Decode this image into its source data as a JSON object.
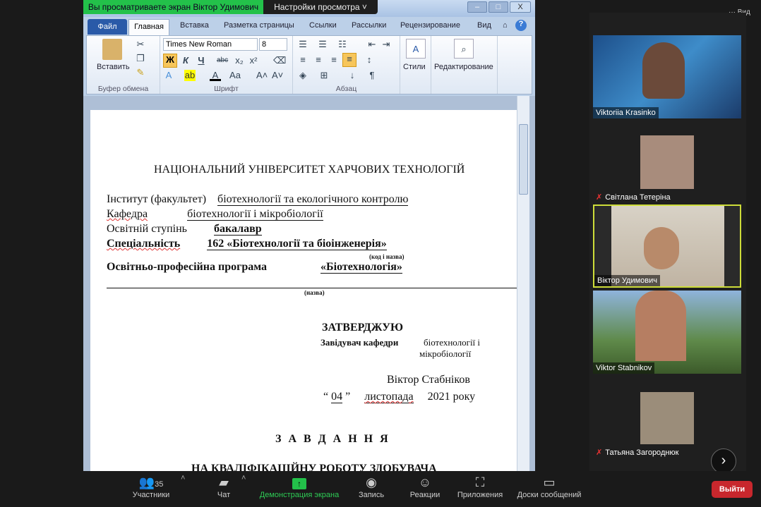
{
  "share_banner": "Вы просматриваете экран Віктор Удимович",
  "view_options": "Настройки просмотра",
  "top_right": "Вид",
  "word": {
    "tabs": [
      "Файл",
      "Главная",
      "Вставка",
      "Разметка страницы",
      "Ссылки",
      "Рассылки",
      "Рецензирование",
      "Вид"
    ],
    "clipboard": {
      "paste": "Вставить",
      "label": "Буфер обмена"
    },
    "font": {
      "name": "Times New Roman",
      "size": "8",
      "label": "Шрифт",
      "bold": "Ж",
      "italic": "К",
      "underline": "Ч"
    },
    "paragraph": {
      "label": "Абзац"
    },
    "styles": "Стили",
    "editing": "Редактирование"
  },
  "doc": {
    "university": "НАЦІОНАЛЬНИЙ УНІВЕРСИТЕТ ХАРЧОВИХ ТЕХНОЛОГІЙ",
    "institute_label": "Інститут (факультет)",
    "institute_value": "біотехнології та екологічного контролю",
    "dept_label": "Кафедра",
    "dept_value": "біотехнології і мікробіології",
    "degree_label": "Освітній ступінь",
    "degree_value": "бакалавр",
    "specialty_label": "Спеціальність",
    "specialty_value": "162 «Біотехнології та біоінженерія»",
    "code_note": "(код і назва)",
    "program_label": "Освітньо-професійна програма",
    "program_value": "«Біотехнологія»",
    "name_note": "(назва)",
    "approve": "ЗАТВЕРДЖУЮ",
    "head_label": "Завідувач кафедри",
    "head_dept1": "біотехнології і",
    "head_dept2": "мікробіології",
    "head_name": "Віктор Стабніков",
    "date_day": "04",
    "date_month": "листопада",
    "date_year": "2021 року",
    "task_title": "З А В Д А Н Н Я",
    "task_sub": "НА КВАЛІФІКАЦІЙНУ РОБОТУ ЗДОБУВАЧА"
  },
  "participants": [
    {
      "name": "Viktoriia Krasinko",
      "muted": false
    },
    {
      "name": "Світлана Тетеріна",
      "muted": true
    },
    {
      "name": "Віктор Удимович",
      "muted": false
    },
    {
      "name": "Viktor Stabnikov",
      "muted": false
    },
    {
      "name": "Татьяна Загороднюк",
      "muted": true
    }
  ],
  "toolbar": {
    "participants": "Участники",
    "participants_count": "35",
    "chat": "Чат",
    "share": "Демонстрация экрана",
    "record": "Запись",
    "reactions": "Реакции",
    "apps": "Приложения",
    "whiteboards": "Доски сообщений",
    "leave": "Выйти"
  },
  "colors": {
    "share_green": "#23c14a",
    "leave_red": "#c8272d",
    "speaker_border": "#cddc39"
  }
}
